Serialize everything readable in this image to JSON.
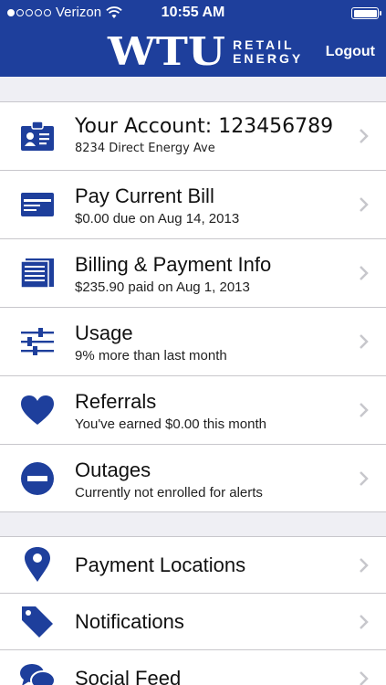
{
  "status_bar": {
    "carrier": "Verizon",
    "time": "10:55 AM",
    "signal_dots_filled": 1,
    "signal_dots_total": 5,
    "battery_level": 1.0
  },
  "header": {
    "logo_main": "WTU",
    "logo_sub_line1": "RETAIL",
    "logo_sub_line2": "ENERGY",
    "logo_tm": "™",
    "logout_label": "Logout"
  },
  "menu": [
    {
      "title": "Your Account: 123456789",
      "subtitle": "8234 Direct Energy Ave",
      "icon": "id-badge-icon"
    },
    {
      "title": "Pay Current Bill",
      "subtitle": "$0.00 due on Aug 14, 2013",
      "icon": "credit-card-icon"
    },
    {
      "title": "Billing & Payment Info",
      "subtitle": "$235.90 paid on Aug 1, 2013",
      "icon": "document-icon"
    },
    {
      "title": "Usage",
      "subtitle": "9% more than last month",
      "icon": "sliders-icon"
    },
    {
      "title": "Referrals",
      "subtitle": "You've earned $0.00 this month",
      "icon": "heart-icon"
    },
    {
      "title": "Outages",
      "subtitle": "Currently not enrolled for alerts",
      "icon": "minus-circle-icon"
    }
  ],
  "menu2": [
    {
      "title": "Payment Locations",
      "icon": "map-pin-icon"
    },
    {
      "title": "Notifications",
      "icon": "tag-icon"
    },
    {
      "title": "Social Feed",
      "icon": "speech-bubbles-icon"
    }
  ],
  "colors": {
    "brand_blue": "#1e3f9c",
    "icon_blue": "#1e3f9c",
    "background": "#efeff4",
    "chevron": "#c7c7cc"
  }
}
